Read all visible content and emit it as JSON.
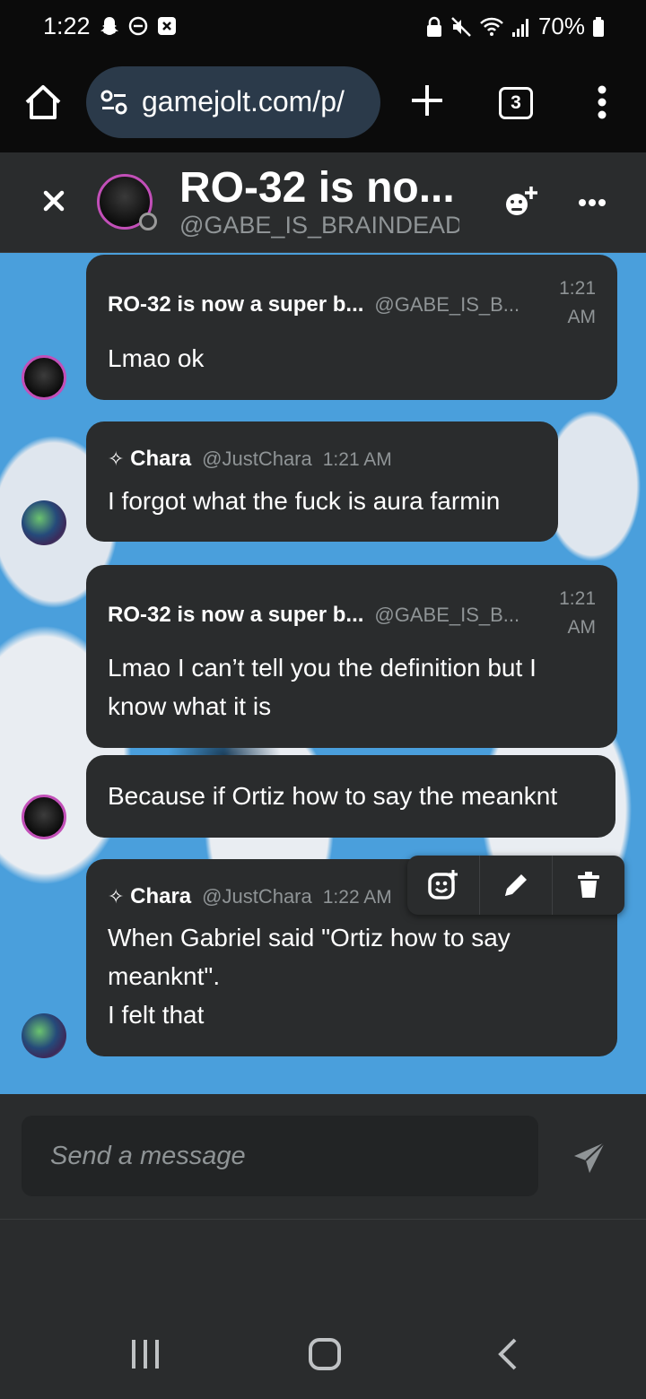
{
  "status_bar": {
    "time": "1:22",
    "battery": "70%",
    "icons_left": [
      "snapchat-icon",
      "do-not-disturb-icon",
      "close-box-icon"
    ],
    "icons_right": [
      "lock-icon",
      "mute-icon",
      "wifi-icon",
      "signal-icon",
      "battery-icon"
    ]
  },
  "browser": {
    "url": "gamejolt.com/p/ ",
    "tab_count": "3"
  },
  "chat_header": {
    "title": "RO-32 is no...",
    "subtitle": "@GABE_IS_BRAINDEAD_a"
  },
  "messages": [
    {
      "name": "RO-32 is now a super b...",
      "handle": "@GABE_IS_B...",
      "time_line1": "1:21",
      "time_line2": "AM",
      "lines": [
        "Lmao ok"
      ]
    },
    {
      "name": "Chara",
      "handle": "@JustChara",
      "time": "1:21 AM",
      "lines": [
        "I forgot what the fuck is aura farmin"
      ]
    },
    {
      "name": "RO-32 is now a super b...",
      "handle": "@GABE_IS_B...",
      "time_line1": "1:21",
      "time_line2": "AM",
      "lines": [
        "Lmao I can’t tell you the definition but I",
        "know what it is"
      ]
    },
    {
      "lines": [
        "Because if Ortiz how to say the meanknt"
      ]
    },
    {
      "name": "Chara",
      "handle": "@JustChara",
      "time": "1:22 AM",
      "lines": [
        "When Gabriel said \"Ortiz how to say",
        "meanknt\".",
        "I felt that"
      ]
    }
  ],
  "input": {
    "placeholder": "Send a message"
  },
  "colors": {
    "chat_bg": "#4a9fdc",
    "bubble": "#2a2c2d",
    "avatar_ring": "#c24fb8",
    "muted_text": "#8f9496"
  }
}
